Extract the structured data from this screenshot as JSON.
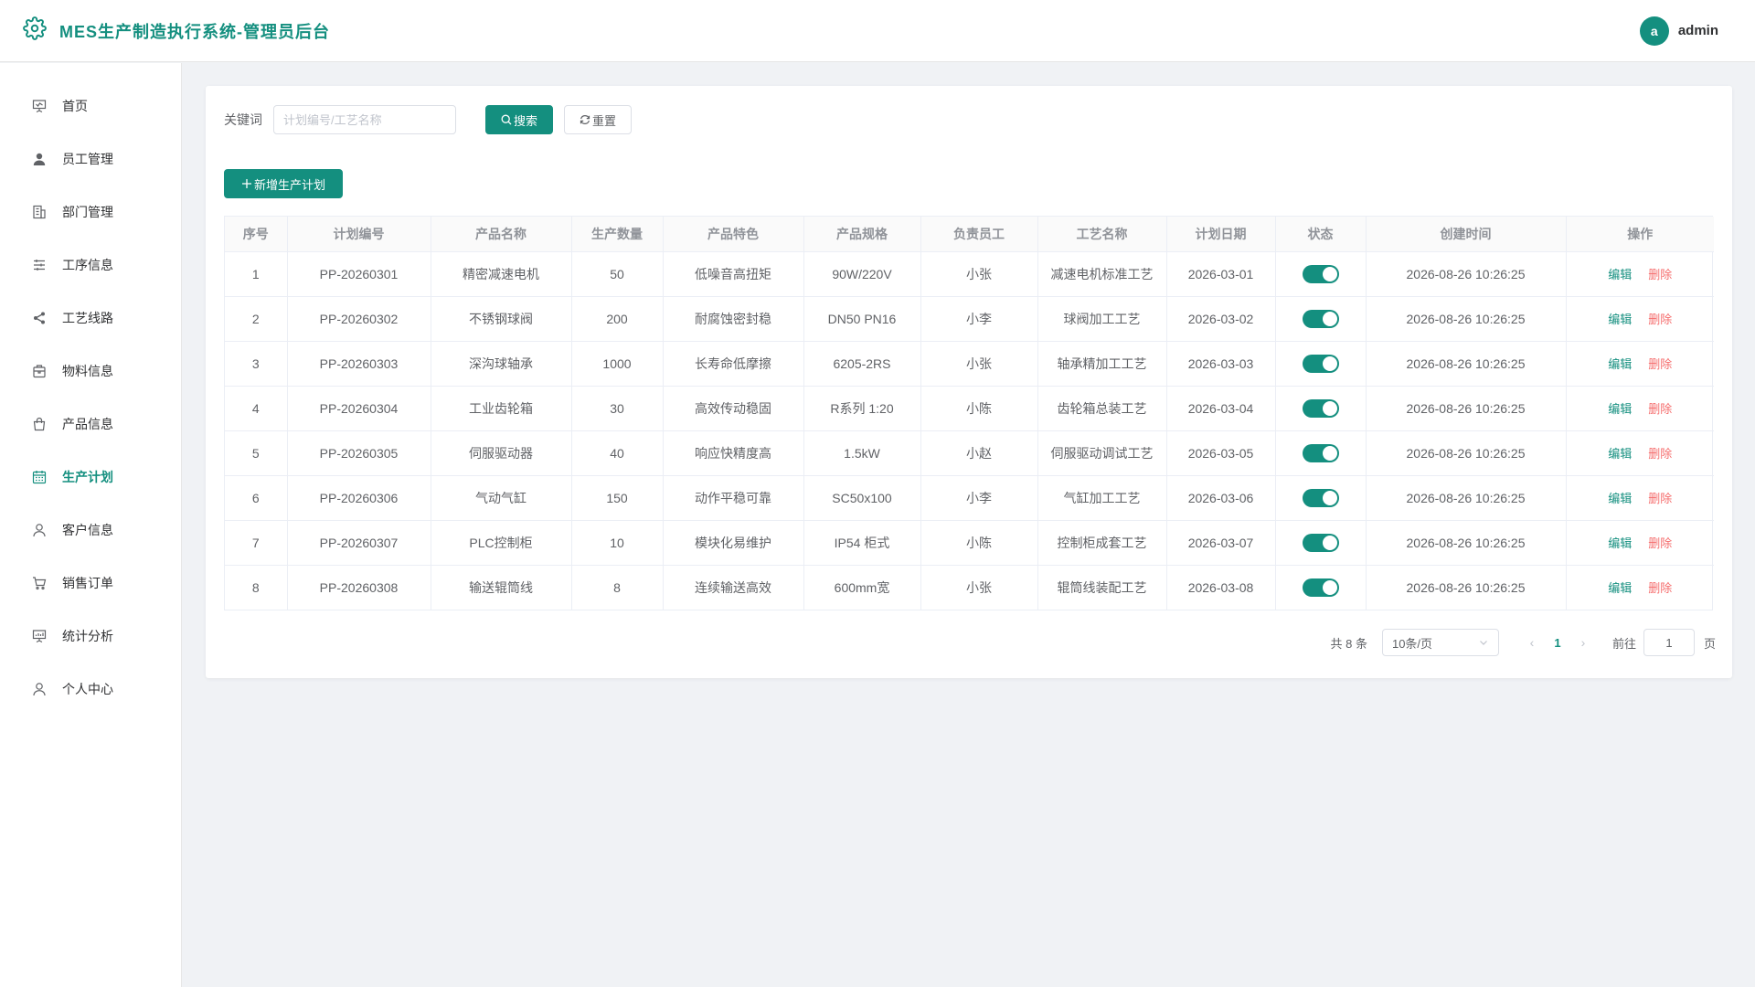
{
  "app": {
    "title": "MES生产制造执行系统-管理员后台",
    "brand_icon": "gear-icon",
    "accent_color": "#148f7f"
  },
  "user": {
    "avatar_letter": "a",
    "name": "admin"
  },
  "sidebar": {
    "items": [
      {
        "label": "首页",
        "icon": "presentation-board-icon",
        "active": false
      },
      {
        "label": "员工管理",
        "icon": "user-filled-icon",
        "active": false
      },
      {
        "label": "部门管理",
        "icon": "office-building-icon",
        "active": false
      },
      {
        "label": "工序信息",
        "icon": "sliders-icon",
        "active": false
      },
      {
        "label": "工艺线路",
        "icon": "share-icon",
        "active": false
      },
      {
        "label": "物料信息",
        "icon": "box-icon",
        "active": false
      },
      {
        "label": "产品信息",
        "icon": "shopping-bag-icon",
        "active": false
      },
      {
        "label": "生产计划",
        "icon": "calendar-icon",
        "active": true
      },
      {
        "label": "客户信息",
        "icon": "user-icon",
        "active": false
      },
      {
        "label": "销售订单",
        "icon": "shopping-cart-icon",
        "active": false
      },
      {
        "label": "统计分析",
        "icon": "presentation-chart-icon",
        "active": false
      },
      {
        "label": "个人中心",
        "icon": "user-icon",
        "active": false
      }
    ]
  },
  "search": {
    "label": "关键词",
    "placeholder": "计划编号/工艺名称",
    "value": "",
    "search_button": "搜索",
    "reset_button": "重置"
  },
  "toolbar": {
    "add_button": "新增生产计划"
  },
  "table": {
    "columns": [
      "序号",
      "计划编号",
      "产品名称",
      "生产数量",
      "产品特色",
      "产品规格",
      "负责员工",
      "工艺名称",
      "计划日期",
      "状态",
      "创建时间",
      "操作"
    ],
    "edit_label": "编辑",
    "delete_label": "删除",
    "rows": [
      [
        "1",
        "PP-20260301",
        "精密减速电机",
        "50",
        "低噪音高扭矩",
        "90W/220V",
        "小张",
        "减速电机标准工艺",
        "2026-03-01",
        true,
        "2026-08-26 10:26:25"
      ],
      [
        "2",
        "PP-20260302",
        "不锈钢球阀",
        "200",
        "耐腐蚀密封稳",
        "DN50 PN16",
        "小李",
        "球阀加工工艺",
        "2026-03-02",
        true,
        "2026-08-26 10:26:25"
      ],
      [
        "3",
        "PP-20260303",
        "深沟球轴承",
        "1000",
        "长寿命低摩擦",
        "6205-2RS",
        "小张",
        "轴承精加工工艺",
        "2026-03-03",
        true,
        "2026-08-26 10:26:25"
      ],
      [
        "4",
        "PP-20260304",
        "工业齿轮箱",
        "30",
        "高效传动稳固",
        "R系列 1:20",
        "小陈",
        "齿轮箱总装工艺",
        "2026-03-04",
        true,
        "2026-08-26 10:26:25"
      ],
      [
        "5",
        "PP-20260305",
        "伺服驱动器",
        "40",
        "响应快精度高",
        "1.5kW",
        "小赵",
        "伺服驱动调试工艺",
        "2026-03-05",
        true,
        "2026-08-26 10:26:25"
      ],
      [
        "6",
        "PP-20260306",
        "气动气缸",
        "150",
        "动作平稳可靠",
        "SC50x100",
        "小李",
        "气缸加工工艺",
        "2026-03-06",
        true,
        "2026-08-26 10:26:25"
      ],
      [
        "7",
        "PP-20260307",
        "PLC控制柜",
        "10",
        "模块化易维护",
        "IP54 柜式",
        "小陈",
        "控制柜成套工艺",
        "2026-03-07",
        true,
        "2026-08-26 10:26:25"
      ],
      [
        "8",
        "PP-20260308",
        "输送辊筒线",
        "8",
        "连续输送高效",
        "600mm宽",
        "小张",
        "辊筒线装配工艺",
        "2026-03-08",
        true,
        "2026-08-26 10:26:25"
      ]
    ]
  },
  "pagination": {
    "total_text": "共 8 条",
    "page_size": "10条/页",
    "current_page": "1",
    "goto_label": "前往",
    "goto_value": "1",
    "page_suffix": "页"
  }
}
